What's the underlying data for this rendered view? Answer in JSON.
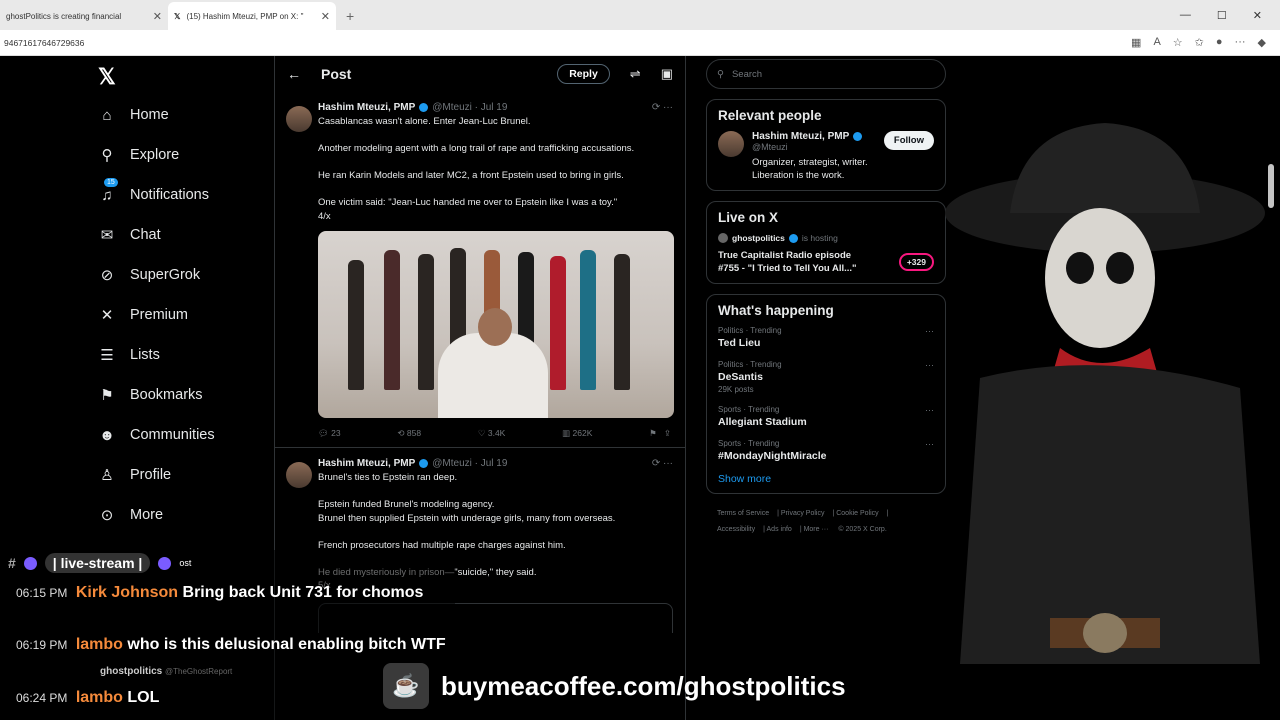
{
  "browser": {
    "tabs": [
      {
        "title": "ghostPolitics is creating financial"
      },
      {
        "title": "(15) Hashim Mteuzi, PMP on X: \""
      }
    ],
    "address": "94671617646729636"
  },
  "nav": {
    "items": [
      {
        "label": "Home",
        "icon": "home-icon"
      },
      {
        "label": "Explore",
        "icon": "search-icon"
      },
      {
        "label": "Notifications",
        "icon": "bell-icon",
        "badge": "15"
      },
      {
        "label": "Chat",
        "icon": "mail-icon"
      },
      {
        "label": "SuperGrok",
        "icon": "grok-icon"
      },
      {
        "label": "Premium",
        "icon": "x-icon"
      },
      {
        "label": "Lists",
        "icon": "list-icon"
      },
      {
        "label": "Bookmarks",
        "icon": "bookmark-icon"
      },
      {
        "label": "Communities",
        "icon": "people-icon"
      },
      {
        "label": "Profile",
        "icon": "person-icon"
      },
      {
        "label": "More",
        "icon": "more-icon"
      }
    ]
  },
  "post": {
    "header_title": "Post",
    "reply_label": "Reply",
    "tweets": [
      {
        "name": "Hashim Mteuzi, PMP",
        "handle": "@Mteuzi · Jul 19",
        "text": "Casablancas wasn't alone. Enter Jean-Luc Brunel.\n\nAnother modeling agent with a long trail of rape and trafficking accusations.\n\nHe ran Karin Models and later MC2, a front Epstein used to bring in girls.\n\nOne victim said: \"Jean-Luc handed me over to Epstein like I was a toy.\"\n4/x",
        "replies": "23",
        "reposts": "858",
        "likes": "3.4K",
        "views": "262K"
      },
      {
        "name": "Hashim Mteuzi, PMP",
        "handle": "@Mteuzi · Jul 19",
        "text": "Brunel's ties to Epstein ran deep.\n\nEpstein funded Brunel's modeling agency.\nBrunel then supplied Epstein with underage girls, many from overseas.\n\nFrench prosecutors had multiple rape charges against him.\n\nHe died mysteriously in prison—\"suicide,\" they said.\n5/x"
      }
    ]
  },
  "sidebar": {
    "search_placeholder": "Search",
    "relevant": {
      "title": "Relevant people",
      "name": "Hashim Mteuzi, PMP",
      "handle": "@Mteuzi",
      "follow_label": "Follow",
      "bio": "Organizer, strategist, writer. Liberation is the work."
    },
    "live": {
      "title": "Live on X",
      "host": "ghostpolitics",
      "hosting_text": "is hosting",
      "episode": "True Capitalist Radio episode #755 - \"I Tried to Tell You All...\"",
      "listeners": "+329"
    },
    "happening": {
      "title": "What's happening",
      "trends": [
        {
          "category": "Politics · Trending",
          "topic": "Ted Lieu",
          "posts": ""
        },
        {
          "category": "Politics · Trending",
          "topic": "DeSantis",
          "posts": "29K posts"
        },
        {
          "category": "Sports · Trending",
          "topic": "Allegiant Stadium",
          "posts": ""
        },
        {
          "category": "Sports · Trending",
          "topic": "#MondayNightMiracle",
          "posts": ""
        }
      ],
      "show_more": "Show more"
    },
    "footer": [
      "Terms of Service",
      "Privacy Policy",
      "Cookie Policy",
      "Accessibility",
      "Ads info",
      "More ···",
      "© 2025 X Corp."
    ]
  },
  "overlay": {
    "channel": "| live-stream |",
    "channel_hint": "ost",
    "messages": [
      {
        "time": "06:15 PM",
        "user": "Kirk Johnson",
        "text": "Bring back Unit 731 for chomos"
      },
      {
        "time": "06:19 PM",
        "user": "lambo",
        "text": "who is this delusional enabling bitch WTF"
      },
      {
        "time": "06:24 PM",
        "user": "lambo",
        "text": "LOL"
      }
    ],
    "popup_name": "ghostpolitics",
    "popup_handle": "@TheGhostReport",
    "coffee_url": "buymeacoffee.com/ghostpolitics"
  }
}
